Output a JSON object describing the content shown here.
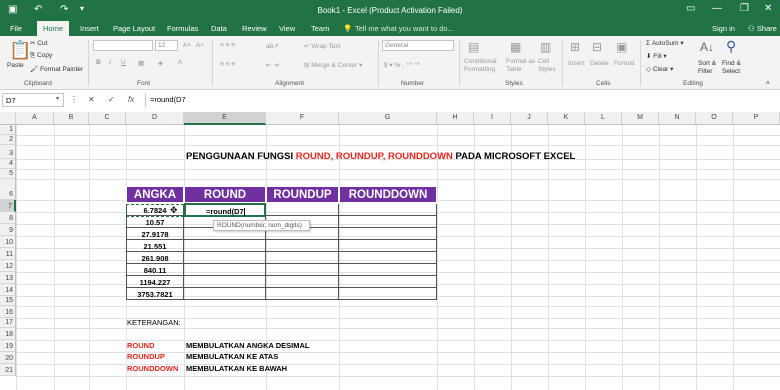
{
  "window": {
    "title": "Book1 - Excel (Product Activation Failed)"
  },
  "tabs": [
    "File",
    "Home",
    "Insert",
    "Page Layout",
    "Formulas",
    "Data",
    "Review",
    "View",
    "Team"
  ],
  "tell_me": "Tell me what you want to do...",
  "account": {
    "signin": "Sign in",
    "share": "Share"
  },
  "ribbon": {
    "paste": "Paste",
    "cut": "Cut",
    "copy": "Copy",
    "format_painter": "Format Painter",
    "clipboard": "Clipboard",
    "font": "Font",
    "font_size": "12",
    "bold": "B",
    "italic": "I",
    "underline": "U",
    "wrap_text": "Wrap Text",
    "merge_center": "Merge & Center",
    "alignment": "Alignment",
    "number_format": "General",
    "number": "Number",
    "conditional": "Conditional Formatting",
    "format_as": "Format as Table",
    "cell_styles": "Cell Styles",
    "styles": "Styles",
    "insert": "Insert",
    "delete": "Delete",
    "format": "Format",
    "cells": "Cells",
    "autosum": "AutoSum",
    "fill": "Fill",
    "clear": "Clear",
    "sort": "Sort & Filter",
    "find": "Find & Select",
    "editing": "Editing"
  },
  "formula_bar": {
    "name_box": "D7",
    "formula": "=round(D7"
  },
  "columns": [
    "A",
    "B",
    "C",
    "D",
    "E",
    "F",
    "G",
    "H",
    "I",
    "J",
    "K",
    "L",
    "M",
    "N",
    "O",
    "P"
  ],
  "rows": [
    "1",
    "2",
    "3",
    "4",
    "5",
    "6",
    "7",
    "8",
    "9",
    "10",
    "11",
    "12",
    "13",
    "14",
    "15",
    "16",
    "17",
    "18",
    "19",
    "20",
    "21"
  ],
  "sheet": {
    "title_black1": "PENGGUNAAN FUNGSI ",
    "title_red": "ROUND, ROUNDUP, ROUNDDOWN",
    "title_black2": " PADA MICROSOFT EXCEL",
    "headers": [
      "ANGKA",
      "ROUND",
      "ROUNDUP",
      "ROUNDDOWN"
    ],
    "values": [
      "6.7824",
      "10.57",
      "27.9178",
      "21.551",
      "261.908",
      "840.11",
      "1194.227",
      "3753.7821"
    ],
    "editing_cell": "=round(D7",
    "tooltip": "ROUND(number, num_digits)",
    "keterangan": "KETERANGAN:",
    "notes": [
      {
        "fn": "ROUND",
        "desc": "MEMBULATKAN ANGKA DESIMAL"
      },
      {
        "fn": "ROUNDUP",
        "desc": "MEMBULATKAN KE ATAS"
      },
      {
        "fn": "ROUNDDOWN",
        "desc": "MEMBULATKAN KE BAWAH"
      }
    ]
  },
  "colors": {
    "excel_green": "#217346",
    "header_purple": "#7030a0",
    "accent_red": "#e3261c"
  }
}
